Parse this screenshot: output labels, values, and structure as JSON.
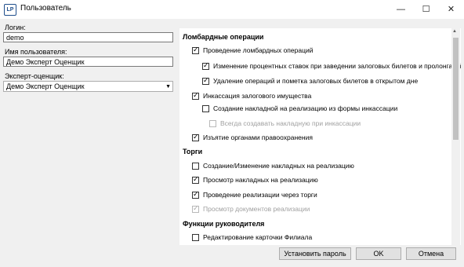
{
  "window": {
    "app_icon": "LP",
    "title": "Пользователь",
    "minimize_glyph": "—",
    "maximize_glyph": "☐",
    "close_glyph": "✕"
  },
  "left": {
    "login_label": "Логин:",
    "login_value": "demo",
    "username_label": "Имя пользователя:",
    "username_value": "Демо Эксперт Оценщик",
    "expert_label": "Эксперт-оценщик:",
    "expert_value": "Демо Эксперт Оценщик",
    "expert_arrow": "▼"
  },
  "sections": {
    "lombard": {
      "title": "Ломбардные операции",
      "items": [
        {
          "label": "Проведение ломбардных операций",
          "checked": true,
          "disabled": false
        },
        {
          "label": "Изменение процентных ставок при заведении залоговых билетов и пролонгаций",
          "checked": true,
          "disabled": false
        },
        {
          "label": "Удаление операций и пометка залоговых билетов в открытом дне",
          "checked": true,
          "disabled": false
        },
        {
          "label": "Инкассация залогового имущества",
          "checked": true,
          "disabled": false
        },
        {
          "label": "Создание накладной на реализацию из формы инкассации",
          "checked": false,
          "disabled": false
        },
        {
          "label": "Всегда создавать накладную при инкассации",
          "checked": false,
          "disabled": true
        },
        {
          "label": "Изъятие органами правоохранения",
          "checked": true,
          "disabled": false
        }
      ]
    },
    "trade": {
      "title": "Торги",
      "items": [
        {
          "label": "Создание/Изменение накладных на реализацию",
          "checked": false,
          "disabled": false
        },
        {
          "label": "Просмотр накладных на реализацию",
          "checked": true,
          "disabled": false
        },
        {
          "label": "Проведение реализации через торги",
          "checked": true,
          "disabled": false
        },
        {
          "label": "Просмотр документов реализации",
          "checked": true,
          "disabled": true
        }
      ]
    },
    "manager": {
      "title": "Функции руководителя",
      "items": [
        {
          "label": "Редактирование карточки Филиала",
          "checked": false,
          "disabled": false
        }
      ]
    }
  },
  "buttons": {
    "set_password": "Установить пароль",
    "ok": "OK",
    "cancel": "Отмена"
  },
  "scrollbar": {
    "up_arrow": "▲"
  }
}
